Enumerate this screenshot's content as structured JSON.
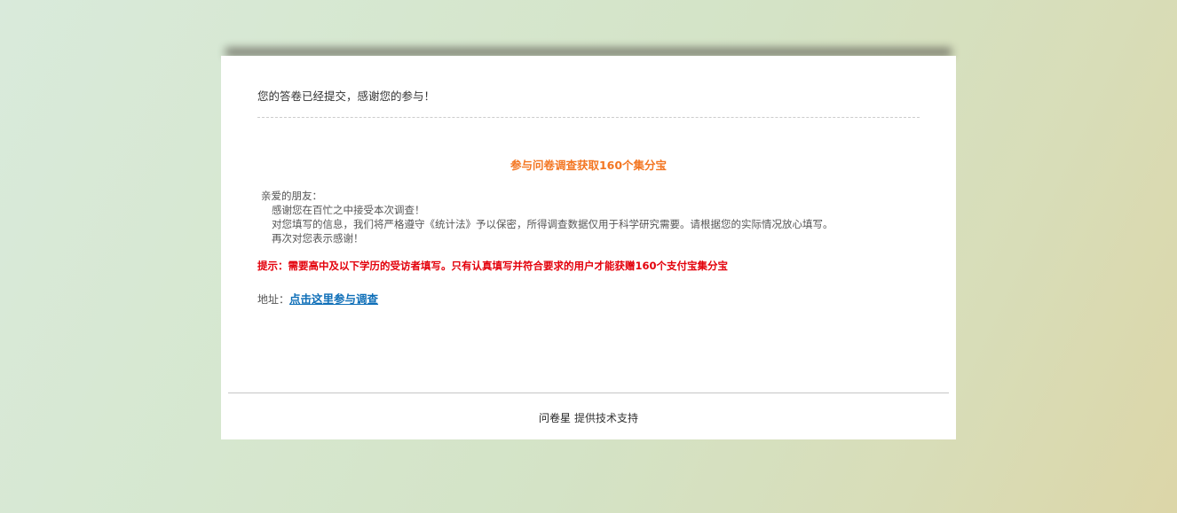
{
  "result": {
    "submitted_message": "您的答卷已经提交，感谢您的参与！"
  },
  "promo": {
    "title": "参与问卷调查获取160个集分宝",
    "greeting_lines": [
      "亲爱的朋友：",
      "感谢您在百忙之中接受本次调查！",
      "对您填写的信息，我们将严格遵守《统计法》予以保密，所得调查数据仅用于科学研究需要。请根据您的实际情况放心填写。",
      "再次对您表示感谢！"
    ],
    "notice": "提示：需要高中及以下学历的受访者填写。只有认真填写并符合要求的用户才能获赠160个支付宝集分宝",
    "address_label": "地址：",
    "address_link_text": "点击这里参与调查"
  },
  "footer": {
    "brand": "问卷星",
    "support_text": "提供技术支持"
  },
  "colors": {
    "promo_title": "#f37622",
    "notice": "#e3000b",
    "link": "#0f6fb8"
  }
}
